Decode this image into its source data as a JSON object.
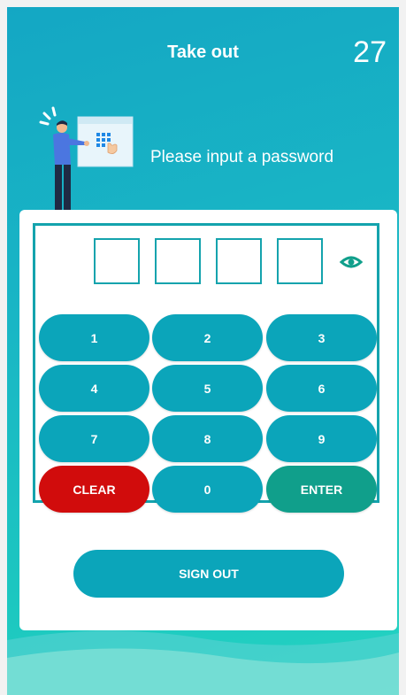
{
  "header": {
    "title": "Take out",
    "countdown": "27"
  },
  "prompt": {
    "text": "Please input a password"
  },
  "password": {
    "digits_entered": 0,
    "max_digits": 4,
    "visibility_icon": "eye-icon"
  },
  "keypad": {
    "keys": [
      "1",
      "2",
      "3",
      "4",
      "5",
      "6",
      "7",
      "8",
      "9",
      "CLEAR",
      "0",
      "ENTER"
    ]
  },
  "actions": {
    "sign_out_label": "SIGN OUT"
  },
  "colors": {
    "primary": "#0ba5ba",
    "clear": "#d10c0c",
    "enter": "#109f8b",
    "border": "#14a3ad"
  }
}
